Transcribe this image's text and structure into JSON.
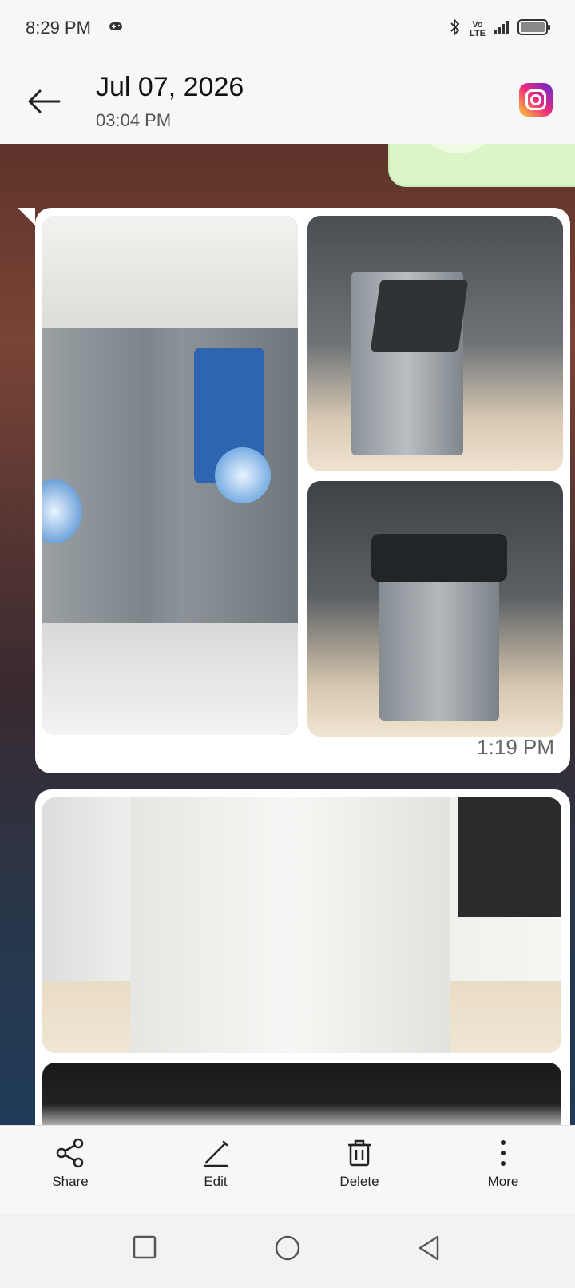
{
  "status_bar": {
    "time": "8:29 PM",
    "icons": [
      "gamepad-icon",
      "bluetooth-icon",
      "volte-icon",
      "signal-icon",
      "battery-icon"
    ],
    "volte_top": "Vo",
    "volte_bottom": "LTE"
  },
  "header": {
    "date": "Jul 07, 2026",
    "time": "03:04 PM",
    "source_app_icon": "instagram-icon"
  },
  "message": {
    "timestamp": "1:19 PM",
    "bubble_color": "#ffffff",
    "sent_bubble_color": "#dbf6c6"
  },
  "actions": {
    "share": "Share",
    "edit": "Edit",
    "delete": "Delete",
    "more": "More"
  },
  "nav": {
    "icons": [
      "recents-square-icon",
      "home-circle-icon",
      "back-triangle-icon"
    ]
  }
}
